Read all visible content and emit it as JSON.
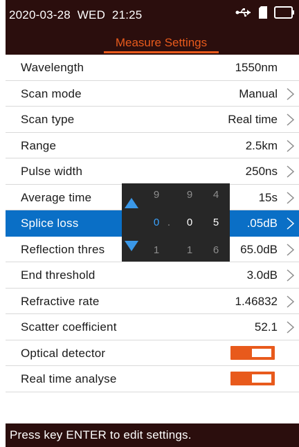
{
  "status": {
    "datetime": "2020-03-28  WED  21:25",
    "icons": [
      "usb-icon",
      "sd-card-icon",
      "battery-icon"
    ]
  },
  "header": {
    "title": "Measure Settings",
    "accent_color": "#e85a1c"
  },
  "settings": [
    {
      "label": "Wavelength",
      "value": "1550nm",
      "has_arrow": false
    },
    {
      "label": "Scan mode",
      "value": "Manual",
      "has_arrow": true
    },
    {
      "label": "Scan type",
      "value": "Real time",
      "has_arrow": true
    },
    {
      "label": "Range",
      "value": "2.5km",
      "has_arrow": true
    },
    {
      "label": "Pulse width",
      "value": "250ns",
      "has_arrow": true
    },
    {
      "label": "Average time",
      "value": "15s",
      "has_arrow": true
    },
    {
      "label": "Splice loss",
      "value": ".05dB",
      "has_arrow": true,
      "selected": true
    },
    {
      "label": "Reflection thres",
      "value": "65.0dB",
      "has_arrow": true
    },
    {
      "label": "End threshold",
      "value": "3.0dB",
      "has_arrow": true
    },
    {
      "label": "Refractive rate",
      "value": "1.46832",
      "has_arrow": true
    },
    {
      "label": "Scatter coefficient",
      "value": "52.1",
      "has_arrow": true
    },
    {
      "label": "Optical detector",
      "toggle": true
    },
    {
      "label": "Real time analyse",
      "toggle": true
    }
  ],
  "picker": {
    "above": [
      "9",
      "9",
      "4"
    ],
    "current": [
      "0",
      "0",
      "5"
    ],
    "separator": ".",
    "below": [
      "1",
      "1",
      "6"
    ]
  },
  "footer": {
    "hint": "Press key ENTER to edit settings."
  },
  "colors": {
    "selection": "#0a6fc6",
    "bar_bg": "#2b0e0d"
  }
}
